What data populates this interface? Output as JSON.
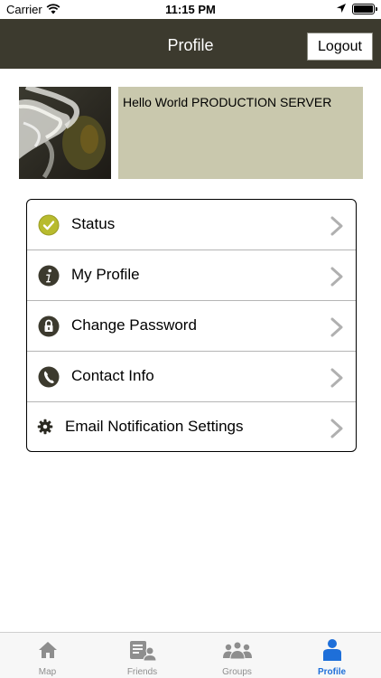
{
  "status_bar": {
    "carrier": "Carrier",
    "time": "11:15 PM"
  },
  "navbar": {
    "title": "Profile",
    "logout_label": "Logout"
  },
  "profile": {
    "greeting": "Hello World PRODUCTION SERVER"
  },
  "menu": {
    "items": [
      {
        "label": "Status",
        "icon": "check-circle-icon"
      },
      {
        "label": "My Profile",
        "icon": "info-icon"
      },
      {
        "label": "Change Password",
        "icon": "lock-icon"
      },
      {
        "label": "Contact Info",
        "icon": "phone-icon"
      },
      {
        "label": "Email Notification Settings",
        "icon": "gear-icon"
      }
    ]
  },
  "tabbar": {
    "tabs": [
      {
        "label": "Map",
        "icon": "home-icon"
      },
      {
        "label": "Friends",
        "icon": "friends-icon"
      },
      {
        "label": "Groups",
        "icon": "groups-icon"
      },
      {
        "label": "Profile",
        "icon": "person-icon",
        "active": true
      }
    ]
  },
  "colors": {
    "navbar_bg": "#3c3a2e",
    "greeting_bg": "#c9c8ad",
    "status_icon": "#b8bb2e",
    "active_tab": "#1e6fd9"
  }
}
